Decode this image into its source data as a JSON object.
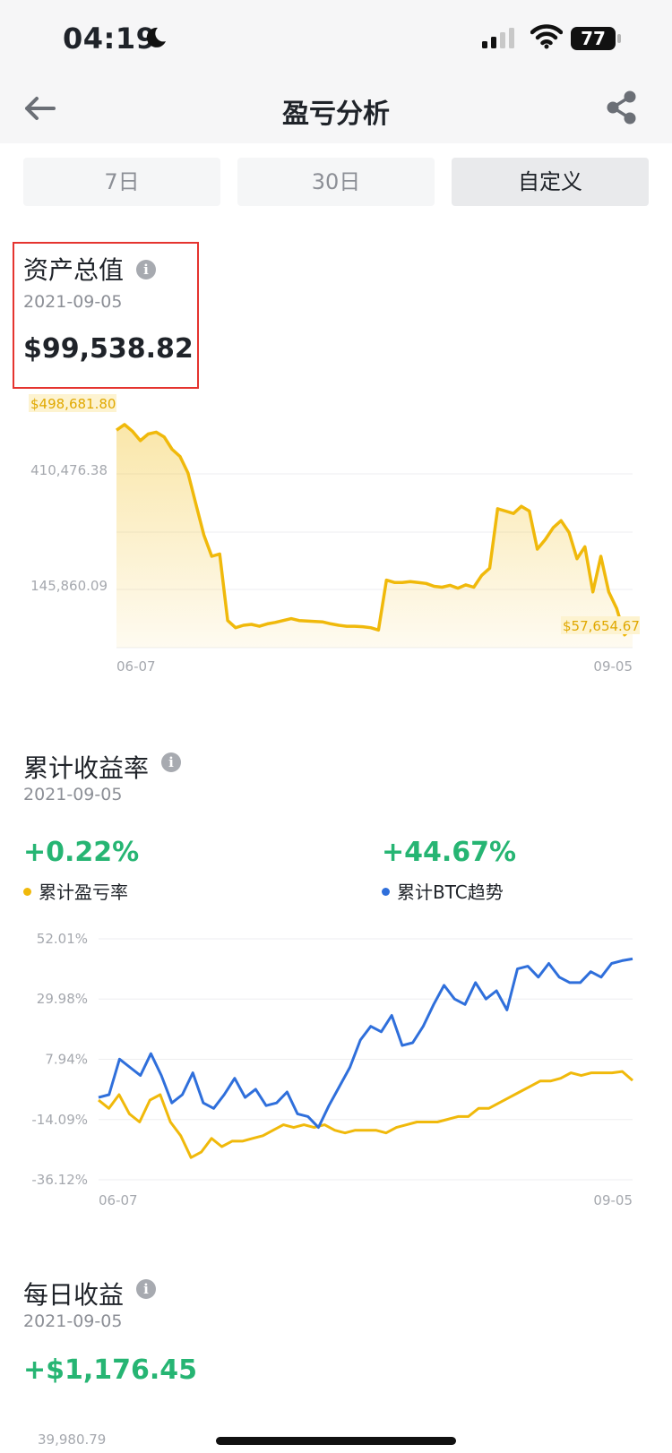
{
  "status_bar": {
    "time": "04:19",
    "battery": "77"
  },
  "header": {
    "title": "盈亏分析"
  },
  "tabs": [
    {
      "label": "7日",
      "active": false
    },
    {
      "label": "30日",
      "active": false
    },
    {
      "label": "自定义",
      "active": true
    }
  ],
  "total_assets": {
    "title": "资产总值",
    "date": "2021-09-05",
    "value": "$99,538.82",
    "chart_data": {
      "type": "area",
      "x_start_label": "06-07",
      "x_end_label": "09-05",
      "y_tick_labels": [
        "410,476.38",
        "145,860.09"
      ],
      "y_ticks": [
        410476.38,
        145860.09
      ],
      "max_label": "$498,681.80",
      "min_label": "$57,654.67",
      "ylim": [
        13000,
        498681.8
      ],
      "color": "#f0b90b",
      "values": [
        470000,
        482000,
        468000,
        448000,
        462000,
        466000,
        456000,
        430000,
        415000,
        380000,
        315000,
        250000,
        205000,
        210000,
        70000,
        55000,
        60000,
        62000,
        58000,
        63000,
        66000,
        70000,
        74000,
        70000,
        69000,
        68000,
        67000,
        63000,
        60000,
        58000,
        58000,
        57000,
        55000,
        50000,
        155000,
        150000,
        150000,
        152000,
        150000,
        148000,
        142000,
        140000,
        144000,
        138000,
        145000,
        140000,
        165000,
        180000,
        305000,
        300000,
        295000,
        310000,
        300000,
        220000,
        240000,
        265000,
        280000,
        255000,
        200000,
        225000,
        130000,
        205000,
        130000,
        95000,
        40000,
        57654.67
      ]
    }
  },
  "cumulative_return": {
    "title": "累计收益率",
    "date": "2021-09-05",
    "pnl_rate": {
      "value": "+0.22%",
      "label": "累计盈亏率"
    },
    "btc_trend": {
      "value": "+44.67%",
      "label": "累计BTC趋势"
    },
    "chart_data": {
      "type": "line",
      "x_start_label": "06-07",
      "x_end_label": "09-05",
      "y_tick_labels": [
        "52.01%",
        "29.98%",
        "7.94%",
        "-14.09%",
        "-36.12%"
      ],
      "y_ticks": [
        52.01,
        29.98,
        7.94,
        -14.09,
        -36.12
      ],
      "ylim": [
        -36.12,
        52.01
      ],
      "series": [
        {
          "name": "累计盈亏率",
          "color": "#f0b90b",
          "values": [
            -7,
            -10,
            -5,
            -12,
            -15,
            -7,
            -5,
            -15,
            -20,
            -28,
            -26,
            -21,
            -24,
            -22,
            -22,
            -21,
            -20,
            -18,
            -16,
            -17,
            -16,
            -17,
            -16,
            -18,
            -19,
            -18,
            -18,
            -18,
            -19,
            -17,
            -16,
            -15,
            -15,
            -15,
            -14,
            -13,
            -13,
            -10,
            -10,
            -8,
            -6,
            -4,
            -2,
            0,
            0,
            1,
            3,
            2,
            3,
            3,
            3,
            3.5,
            0.22
          ]
        },
        {
          "name": "累计BTC趋势",
          "color": "#2f6fdb",
          "values": [
            -6,
            -5,
            8,
            5,
            2,
            10,
            2,
            -8,
            -5,
            3,
            -8,
            -10,
            -5,
            1,
            -6,
            -3,
            -9,
            -8,
            -4,
            -12,
            -13,
            -17,
            -9,
            -2,
            5,
            15,
            20,
            18,
            24,
            13,
            14,
            20,
            28,
            35,
            30,
            28,
            36,
            30,
            33,
            26,
            41,
            42,
            38,
            43,
            38,
            36,
            36,
            40,
            38,
            43,
            44,
            44.67
          ]
        }
      ]
    }
  },
  "daily_earnings": {
    "title": "每日收益",
    "date": "2021-09-05",
    "value": "+$1,176.45",
    "axis_label": "39,980.79"
  }
}
